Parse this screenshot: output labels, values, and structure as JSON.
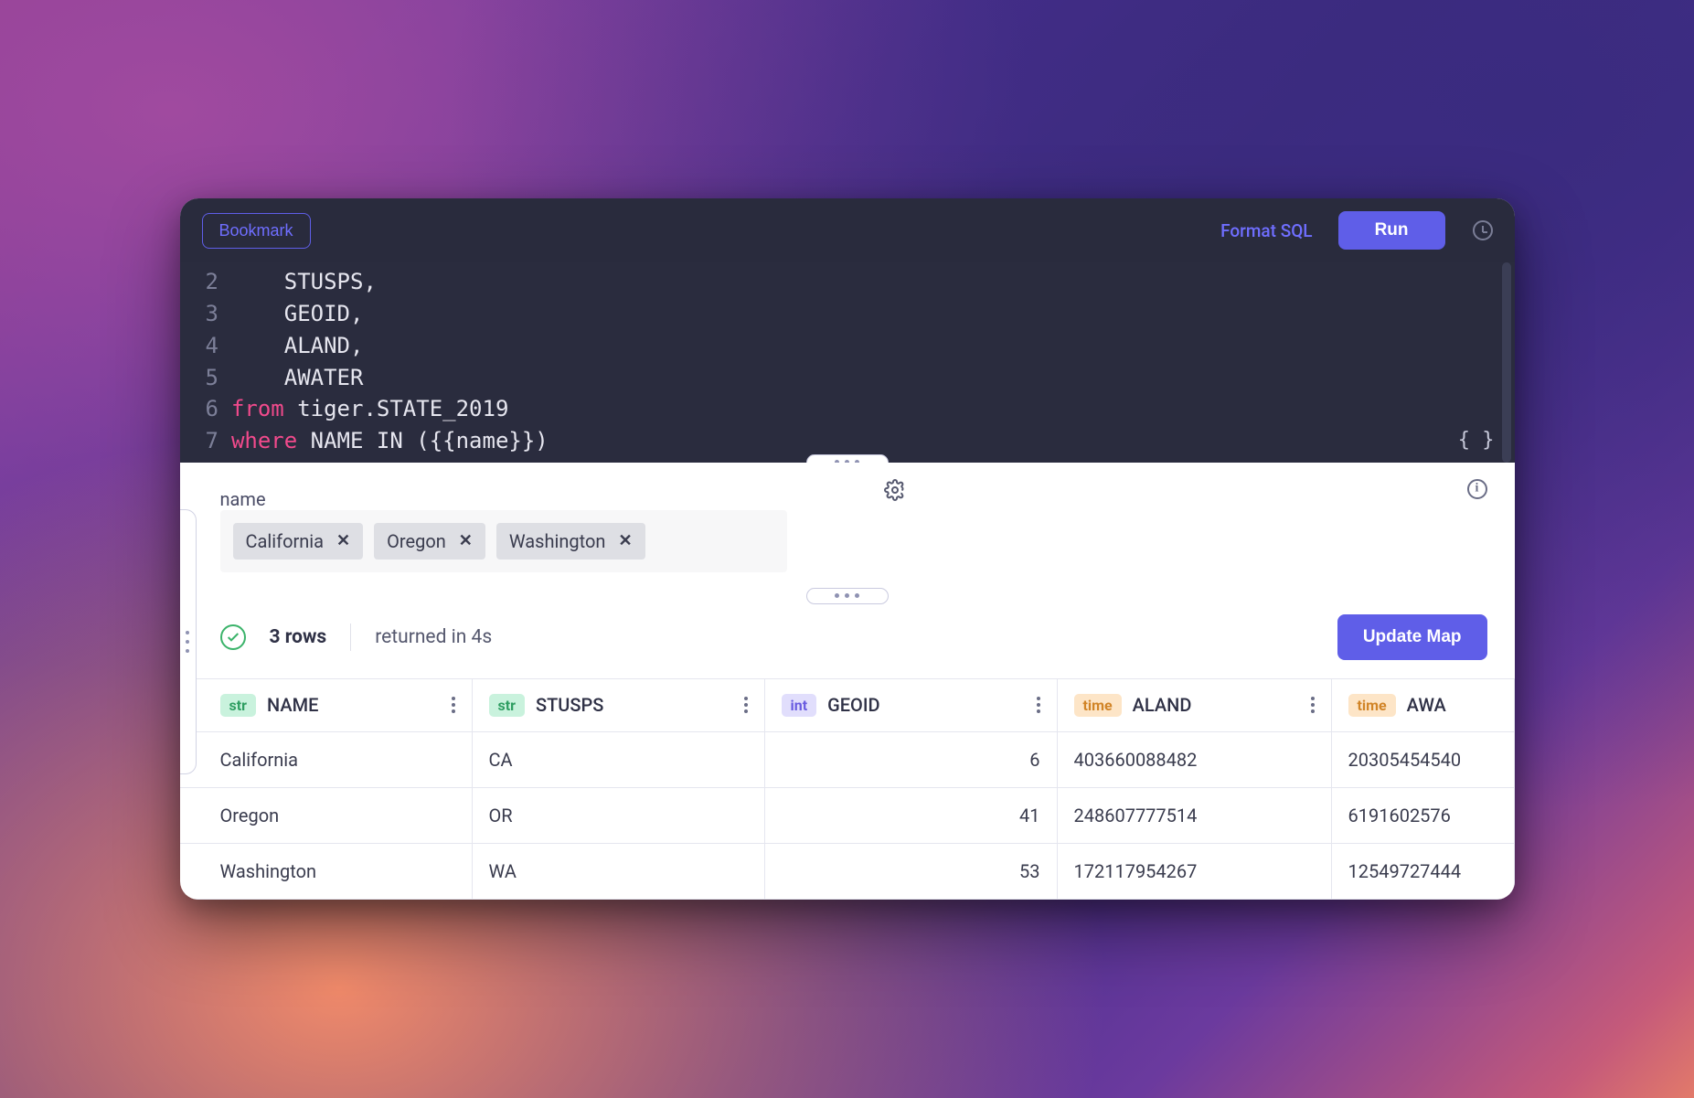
{
  "toolbar": {
    "bookmark_label": "Bookmark",
    "format_label": "Format SQL",
    "run_label": "Run"
  },
  "editor": {
    "gutter": [
      "2",
      "3",
      "4",
      "5",
      "6",
      "7"
    ],
    "lines": {
      "l2": "    STUSPS,",
      "l3": "    GEOID,",
      "l4": "    ALAND,",
      "l5": "    AWATER",
      "l6_kw": "from",
      "l6_rest": " tiger.STATE_2019",
      "l7_kw": "where",
      "l7_rest": " NAME IN (",
      "l7_tpl": "{{name}}",
      "l7_end": ")"
    },
    "braces": "{ }"
  },
  "params": {
    "label": "name",
    "chips": [
      "California",
      "Oregon",
      "Washington"
    ]
  },
  "results": {
    "rows_label": "3 rows",
    "returned_label": "returned in 4s",
    "update_label": "Update Map",
    "columns": [
      {
        "type": "str",
        "name": "NAME"
      },
      {
        "type": "str",
        "name": "STUSPS"
      },
      {
        "type": "int",
        "name": "GEOID"
      },
      {
        "type": "time",
        "name": "ALAND"
      },
      {
        "type": "time",
        "name": "AWA"
      }
    ],
    "rows": [
      {
        "NAME": "California",
        "STUSPS": "CA",
        "GEOID": "6",
        "ALAND": "403660088482",
        "AWA": "20305454540"
      },
      {
        "NAME": "Oregon",
        "STUSPS": "OR",
        "GEOID": "41",
        "ALAND": "248607777514",
        "AWA": "6191602576"
      },
      {
        "NAME": "Washington",
        "STUSPS": "WA",
        "GEOID": "53",
        "ALAND": "172117954267",
        "AWA": "12549727444"
      }
    ]
  }
}
